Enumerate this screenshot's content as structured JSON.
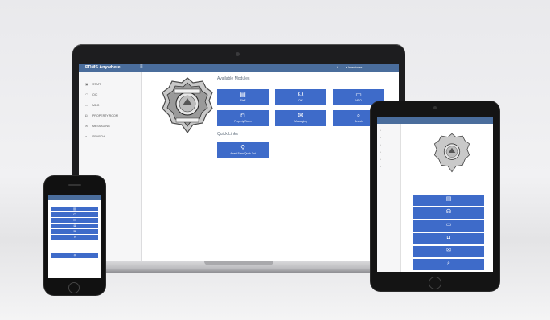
{
  "app": {
    "brand": "PDMS Anywhere",
    "menu_icon": "hamburger-icon",
    "notification_icon": "bell-icon",
    "user_menu": "▾ Inventories"
  },
  "sidebar": {
    "items": [
      {
        "label": "Staff",
        "icon": "id-card-icon",
        "glyph": "▣"
      },
      {
        "label": "OIC",
        "icon": "headset-icon",
        "glyph": "◠"
      },
      {
        "label": "MDO",
        "icon": "monitor-icon",
        "glyph": "▭"
      },
      {
        "label": "Property Room",
        "icon": "inbox-icon",
        "glyph": "◘"
      },
      {
        "label": "Messaging",
        "icon": "comments-icon",
        "glyph": "✉"
      },
      {
        "label": "Search",
        "icon": "search-icon",
        "glyph": "⌕"
      }
    ]
  },
  "main": {
    "available_modules_title": "Available Modules",
    "quick_links_title": "Quick Links",
    "modules": [
      {
        "label": "Staff",
        "icon": "id-card-icon",
        "glyph": "▤"
      },
      {
        "label": "OIC",
        "icon": "headset-icon",
        "glyph": "☊"
      },
      {
        "label": "MDO",
        "icon": "monitor-icon",
        "glyph": "▭"
      },
      {
        "label": "Property Room",
        "icon": "inbox-icon",
        "glyph": "◘"
      },
      {
        "label": "Messaging",
        "icon": "comments-icon",
        "glyph": "✉"
      },
      {
        "label": "Search",
        "icon": "search-icon",
        "glyph": "⌕"
      }
    ],
    "quick_links": [
      {
        "label": "Arrest Form Quick Ent",
        "icon": "link-icon",
        "glyph": "⚲"
      }
    ]
  },
  "colors": {
    "topbar": "#4a6d9c",
    "tile": "#3e6bc9",
    "sidebar_bg": "#f6f6f7"
  }
}
